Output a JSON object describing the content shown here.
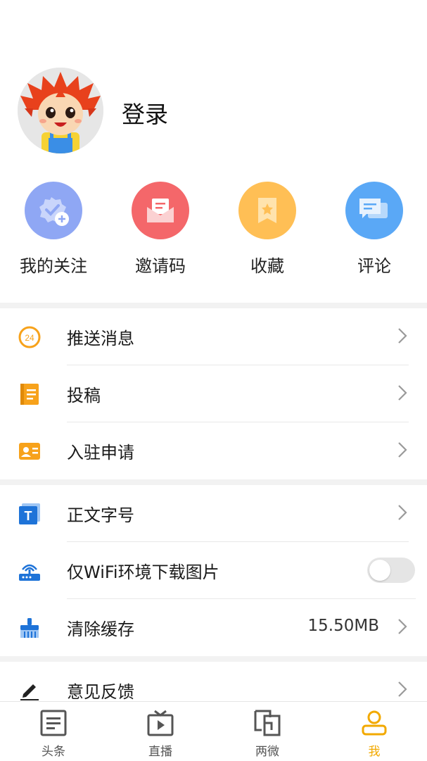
{
  "profile": {
    "login_label": "登录"
  },
  "quick_actions": [
    {
      "label": "我的关注",
      "icon": "follow-badge-icon",
      "color": "#8fa7f4"
    },
    {
      "label": "邀请码",
      "icon": "invite-envelope-icon",
      "color": "#f4676a"
    },
    {
      "label": "收藏",
      "icon": "bookmark-icon",
      "color": "#ffbf55"
    },
    {
      "label": "评论",
      "icon": "comment-bubbles-icon",
      "color": "#5aa8f6"
    }
  ],
  "settings": {
    "push": {
      "label": "推送消息",
      "badge": "24"
    },
    "submit": {
      "label": "投稿"
    },
    "apply": {
      "label": "入驻申请"
    },
    "font_size": {
      "label": "正文字号",
      "icon_letter": "T"
    },
    "wifi_only": {
      "label": "仅WiFi环境下载图片",
      "enabled": false
    },
    "clear_cache": {
      "label": "清除缓存",
      "value": "15.50MB"
    },
    "feedback": {
      "label": "意见反馈"
    }
  },
  "tabbar": {
    "items": [
      {
        "label": "头条"
      },
      {
        "label": "直播"
      },
      {
        "label": "两微"
      },
      {
        "label": "我"
      }
    ],
    "active": "我",
    "active_color": "#f2a900"
  }
}
